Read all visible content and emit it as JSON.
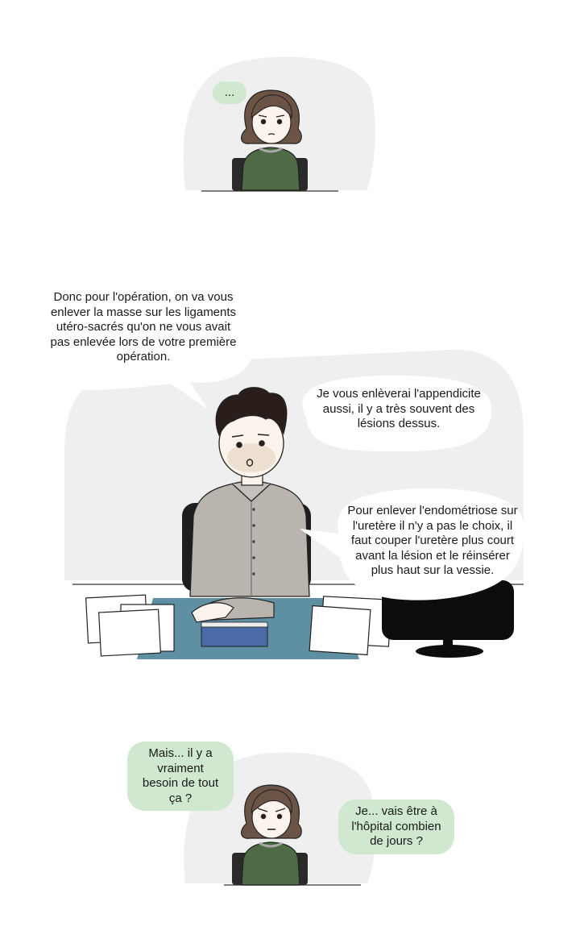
{
  "panel_1": {
    "patient_bubble": "..."
  },
  "panel_2": {
    "doctor_bubble_1": "Donc pour l'opération, on va vous enlever la masse sur les ligaments utéro-sacrés qu'on ne vous avait pas enlevée lors de votre première opération.",
    "doctor_bubble_2": "Je vous enlèverai l'appendicite aussi, il y a très souvent des lésions dessus.",
    "doctor_bubble_3": "Pour enlever l'endométriose sur l'uretère il n'y a pas le choix, il faut couper l'uretère plus court avant la lésion et le réinsérer plus haut sur la vessie."
  },
  "panel_3": {
    "patient_bubble_1": "Mais... il y a vraiment besoin de tout ça ?",
    "patient_bubble_2": "Je... vais être à l'hôpital combien de jours ?"
  },
  "colors": {
    "speech_green": "#cfe8cf",
    "backdrop_gray": "#efefef",
    "sweater_green": "#4e6b45",
    "hair_brown": "#6b5446",
    "doctor_shirt": "#b9b5ae",
    "desk_teal": "#5f8fa3",
    "folder_blue": "#4a6aa8"
  }
}
